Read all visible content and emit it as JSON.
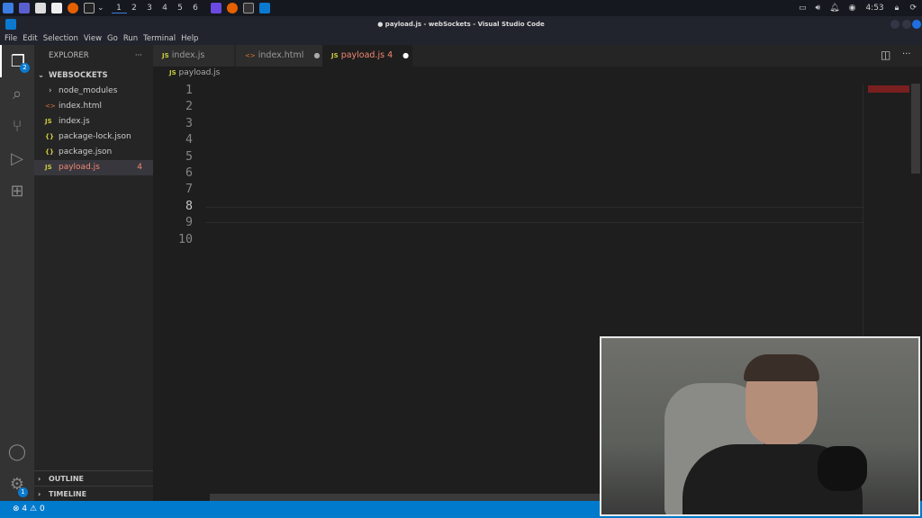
{
  "taskbar": {
    "workspaces": [
      "1",
      "2",
      "3",
      "4",
      "5",
      "6"
    ],
    "clock": "4:53"
  },
  "window": {
    "title": "● payload.js - webSockets - Visual Studio Code"
  },
  "menu": [
    "File",
    "Edit",
    "Selection",
    "View",
    "Go",
    "Run",
    "Terminal",
    "Help"
  ],
  "activity": {
    "explorer_badge": "2",
    "settings_badge": "1"
  },
  "sidebar": {
    "header": "EXPLORER",
    "more": "···",
    "folder": "WEBSOCKETS",
    "items": [
      {
        "icon": "›",
        "name": "node_modules"
      },
      {
        "icon": "<>",
        "name": "index.html"
      },
      {
        "icon": "JS",
        "name": "index.js"
      },
      {
        "icon": "{}",
        "name": "package-lock.json"
      },
      {
        "icon": "{}",
        "name": "package.json"
      },
      {
        "icon": "JS",
        "name": "payload.js",
        "problems": "4"
      }
    ],
    "outline": "OUTLINE",
    "timeline": "TIMELINE"
  },
  "tabs": [
    {
      "icon": "JS",
      "label": "index.js"
    },
    {
      "icon": "<>",
      "label": "index.html",
      "dirty": "●"
    },
    {
      "icon": "JS",
      "label": "payload.js 4",
      "dirty": "●"
    }
  ],
  "breadcrumb": {
    "icon": "JS",
    "file": "payload.js"
  },
  "code": {
    "line_numbers": [
      "1",
      "2",
      "3",
      "4",
      "5",
      "6",
      "7",
      "8",
      "9",
      "10"
    ]
  },
  "status": {
    "errors": "4",
    "warnings": "0"
  }
}
